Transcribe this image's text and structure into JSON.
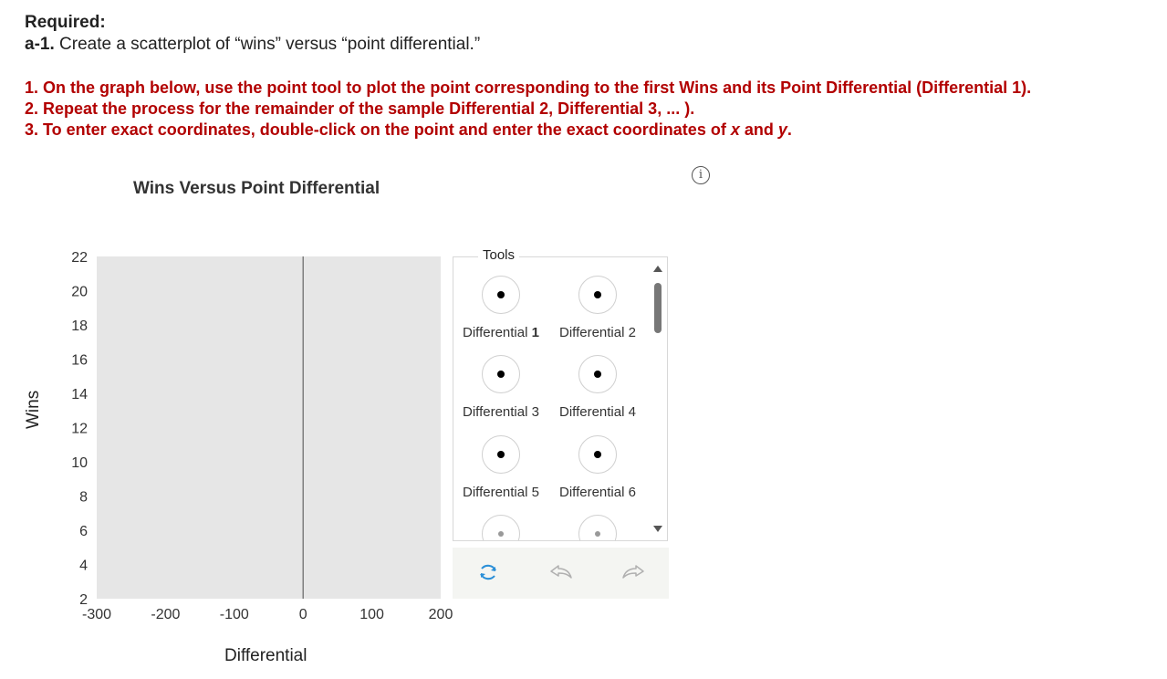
{
  "header": {
    "required_label": "Required:",
    "part_label": "a-1.",
    "part_text": "Create a scatterplot of “wins” versus “point differential.”"
  },
  "instructions": {
    "line1": "1. On the graph below, use the point tool to plot the point corresponding to the first Wins and its Point Differential (Differential 1).",
    "line2": "2. Repeat the process for the remainder of the sample Differential 2, Differential 3, ... ).",
    "line3_start": "3. To enter exact coordinates, double-click on the point and enter the exact coordinates of ",
    "line3_x": "x",
    "line3_and": " and ",
    "line3_y": "y",
    "line3_end": "."
  },
  "info_icon": "info-icon",
  "chart_data": {
    "type": "scatter",
    "title": "Wins Versus Point Differential",
    "xlabel": "Differential",
    "ylabel": "Wins",
    "xlim": [
      -300,
      200
    ],
    "ylim": [
      2,
      22
    ],
    "xticks": [
      -300,
      -200,
      -100,
      0,
      100,
      200
    ],
    "xtick_labels": [
      "-300",
      "-200",
      "-100",
      "0",
      "100",
      "200"
    ],
    "yticks": [
      2,
      4,
      6,
      8,
      10,
      12,
      14,
      16,
      18,
      20,
      22
    ],
    "ytick_labels": [
      "2",
      "4",
      "6",
      "8",
      "10",
      "12",
      "14",
      "16",
      "18",
      "20",
      "22"
    ],
    "points": [],
    "plot_background": "#e6e6e6",
    "grid": false
  },
  "tools": {
    "label": "Tools",
    "items": [
      {
        "prefix": "Differential",
        "num": "1",
        "bold_num": true
      },
      {
        "prefix": "Differential",
        "num": "2",
        "bold_num": false
      },
      {
        "prefix": "Differential",
        "num": "3",
        "bold_num": false
      },
      {
        "prefix": "Differential",
        "num": "4",
        "bold_num": false
      },
      {
        "prefix": "Differential",
        "num": "5",
        "bold_num": false
      },
      {
        "prefix": "Differential",
        "num": "6",
        "bold_num": false
      }
    ]
  },
  "actions": {
    "reset_icon": "reset-icon",
    "undo_icon": "undo-icon",
    "redo_icon": "redo-icon",
    "reset_color": "#2a8fd8"
  },
  "colors": {
    "instruction": "#b20000",
    "text": "#222222"
  }
}
